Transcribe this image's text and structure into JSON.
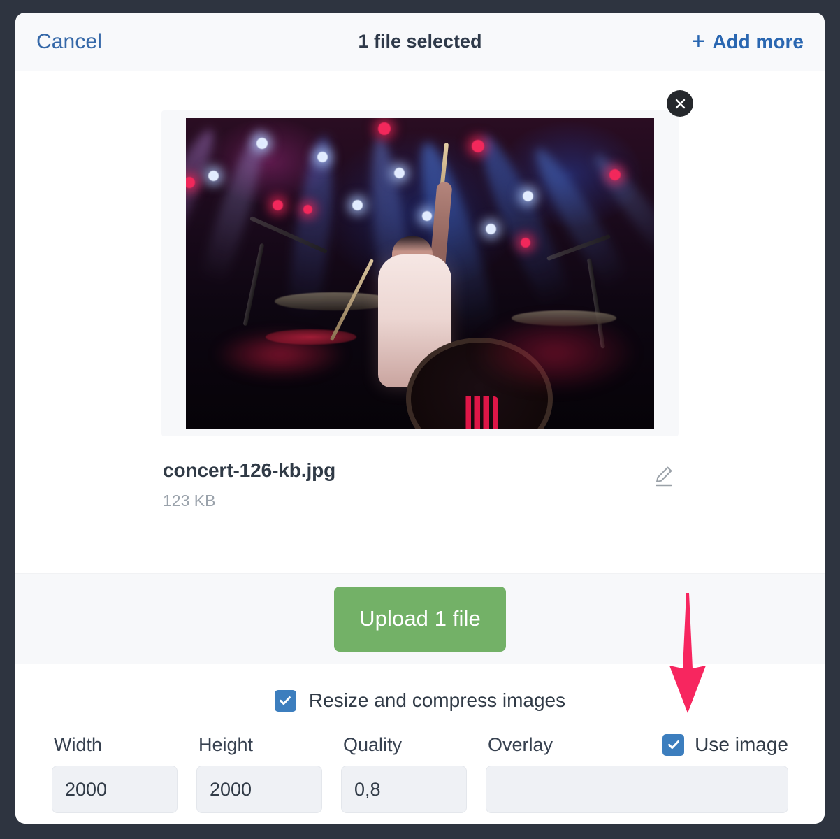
{
  "window": {
    "backdrop_color": "#2e3440",
    "modal_background": "#ffffff"
  },
  "header": {
    "cancel_label": "Cancel",
    "title": "1 file selected",
    "add_more_label": "Add more",
    "add_more_plus": "+",
    "background": "#f8f9fb",
    "link_color": "#2a67b1"
  },
  "file": {
    "name": "concert-126-kb.jpg",
    "size": "123 KB",
    "remove_icon": "close-icon",
    "edit_icon": "pencil-edit-icon",
    "preview_alt": "concert drummer on stage with coloured lights"
  },
  "upload": {
    "button_label": "Upload 1 file",
    "button_color": "#73b167",
    "band_background": "#f7f8fa"
  },
  "options": {
    "resize_checkbox": {
      "label": "Resize and compress images",
      "checked": true,
      "color": "#3c7ebe"
    },
    "fields": [
      {
        "label": "Width",
        "value": "2000",
        "placeholder": ""
      },
      {
        "label": "Height",
        "value": "2000",
        "placeholder": ""
      },
      {
        "label": "Quality",
        "value": "0,8",
        "placeholder": ""
      }
    ],
    "overlay": {
      "label": "Overlay",
      "value": "",
      "placeholder": ""
    },
    "use_image_checkbox": {
      "label": "Use image",
      "checked": true,
      "color": "#3c7ebe"
    }
  },
  "annotation": {
    "arrow": {
      "direction": "down",
      "color": "#f7265f",
      "points_at": "use-image-checkbox"
    }
  }
}
